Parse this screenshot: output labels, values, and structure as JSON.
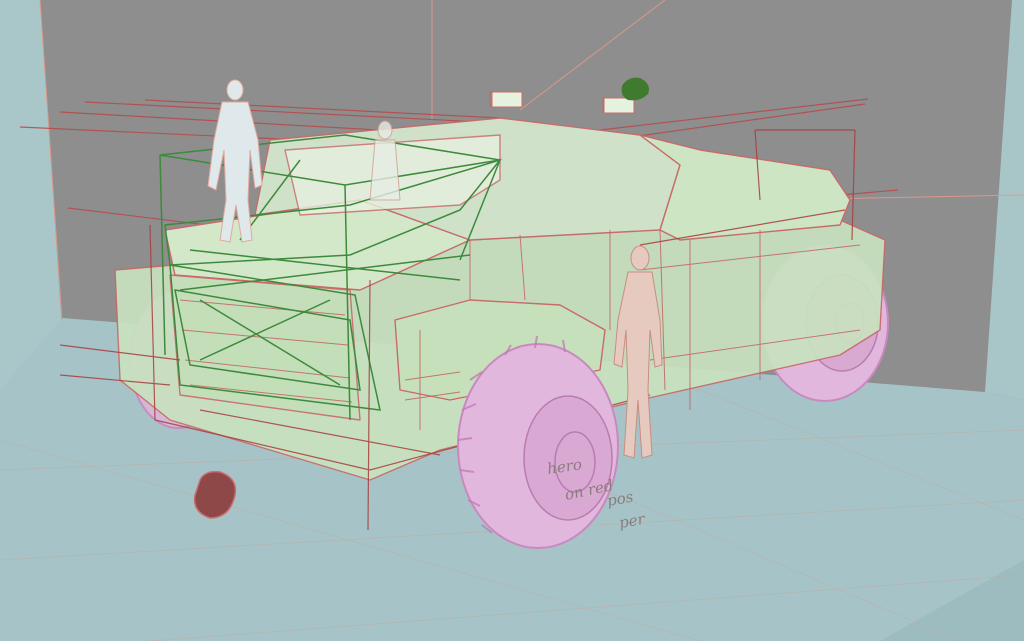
{
  "scene": {
    "kind": "3d-viewport-blockout",
    "subject": "armored off-road vehicle wireframe with human scale figures",
    "colors": {
      "back_wall": "#8e8e8e",
      "left_wall": "#a9c6c8",
      "floor": "#a6c4c7",
      "vehicle_fill": "#cfe6c4",
      "vehicle_line": "#c96a6a",
      "guide_green": "#3d8a3d",
      "guide_red": "#b04040",
      "tire_fill": "#e2b7dd",
      "tire_line": "#c989c0",
      "figure": "#dfe8ea",
      "marker_red": "#8f4848",
      "marker_green": "#3f7a2e"
    }
  },
  "annotations": {
    "note_1": "hero",
    "note_2": "on red",
    "note_3": "pos",
    "note_4": "per"
  }
}
